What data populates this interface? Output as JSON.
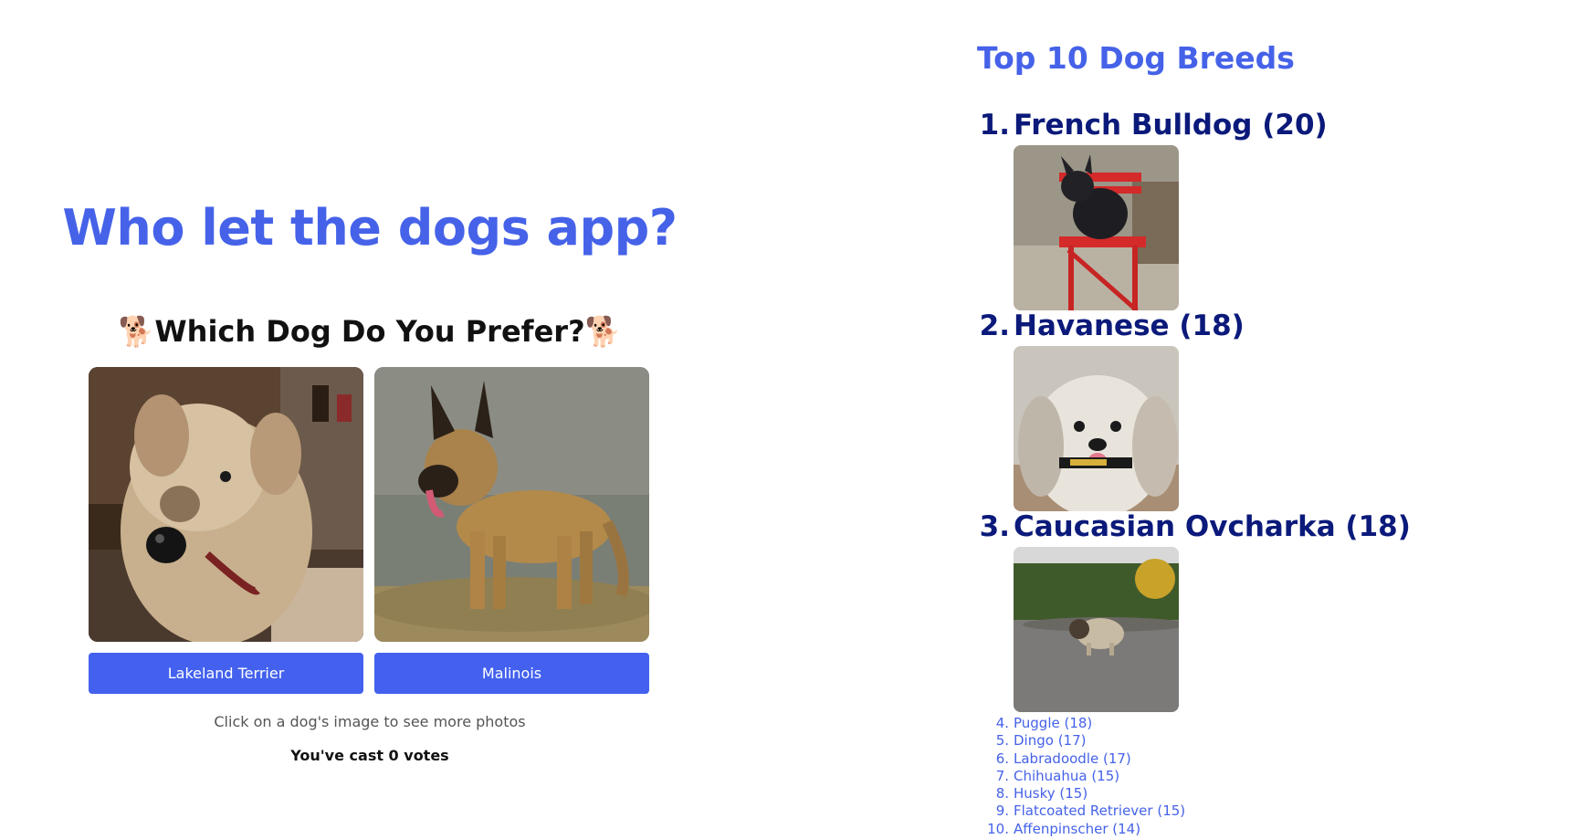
{
  "app": {
    "title": "Who let the dogs app?",
    "subtitle": "Which Dog Do You Prefer?",
    "subtitle_emoji": "🐕",
    "hint": "Click on a dog's image to see more photos",
    "votes_text": "You've cast 0 votes"
  },
  "candidates": [
    {
      "name": "Lakeland Terrier"
    },
    {
      "name": "Malinois"
    }
  ],
  "top": {
    "title": "Top 10 Dog Breeds",
    "featured": [
      {
        "rank": "1.",
        "label": "French Bulldog (20)"
      },
      {
        "rank": "2.",
        "label": "Havanese (18)"
      },
      {
        "rank": "3.",
        "label": "Caucasian Ovcharka (18)"
      }
    ],
    "rest": [
      {
        "rank": "4.",
        "label": "Puggle (18)"
      },
      {
        "rank": "5.",
        "label": "Dingo (17)"
      },
      {
        "rank": "6.",
        "label": "Labradoodle (17)"
      },
      {
        "rank": "7.",
        "label": "Chihuahua (15)"
      },
      {
        "rank": "8.",
        "label": "Husky (15)"
      },
      {
        "rank": "9.",
        "label": "Flatcoated Retriever (15)"
      },
      {
        "rank": "10.",
        "label": "Affenpinscher (14)"
      }
    ]
  },
  "colors": {
    "accent": "#4562e8",
    "button": "#4361ee",
    "rank_text": "#0b1a7a"
  }
}
